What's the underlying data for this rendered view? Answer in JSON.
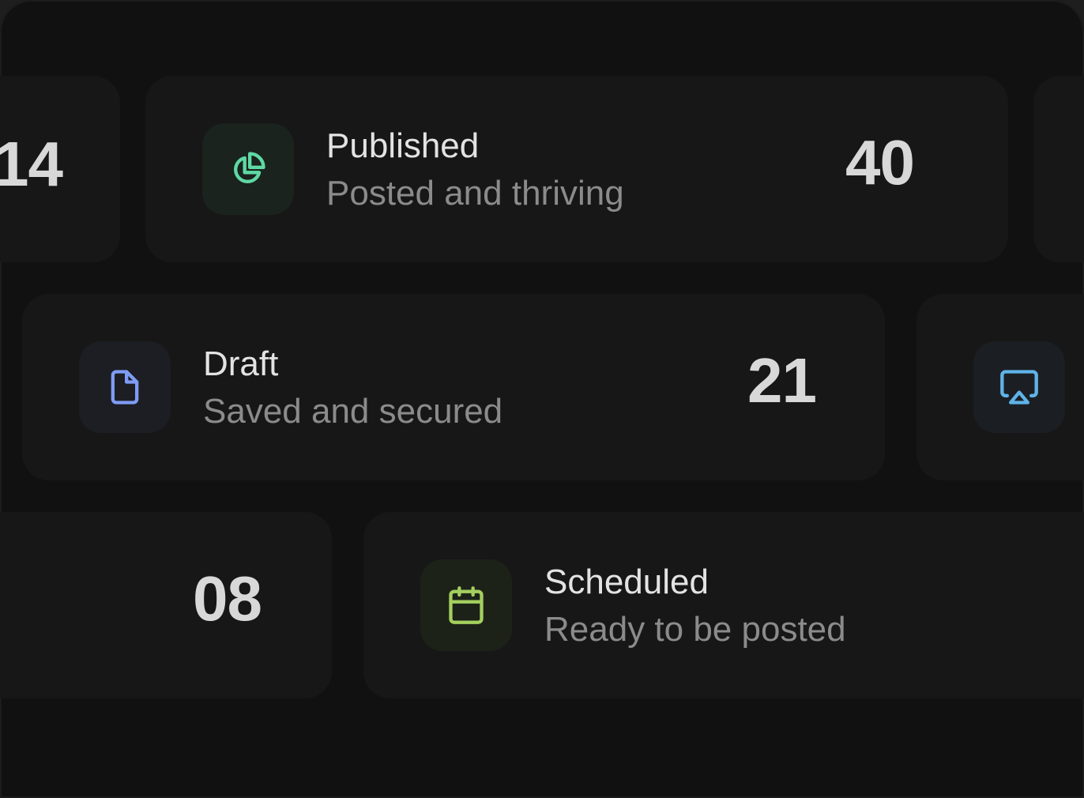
{
  "cards": {
    "partial_top_left": {
      "count": "14"
    },
    "published": {
      "title": "Published",
      "subtitle": "Posted and thriving",
      "count": "40",
      "icon": "pie-chart-icon",
      "accent": "#5fd9a4",
      "icon_bg": "#1a231e"
    },
    "draft": {
      "title": "Draft",
      "subtitle": "Saved and secured",
      "count": "21",
      "icon": "file-icon",
      "accent": "#7e9cf5",
      "icon_bg": "#1c1e24"
    },
    "partial_middle_right": {
      "icon": "airplay-icon",
      "accent": "#5fb3e8",
      "icon_bg": "#1b1f24"
    },
    "partial_bottom_left": {
      "count": "08"
    },
    "scheduled": {
      "title": "Scheduled",
      "subtitle": "Ready to be posted",
      "icon": "calendar-icon",
      "accent": "#a4cf5e",
      "icon_bg": "#1d2219"
    }
  }
}
